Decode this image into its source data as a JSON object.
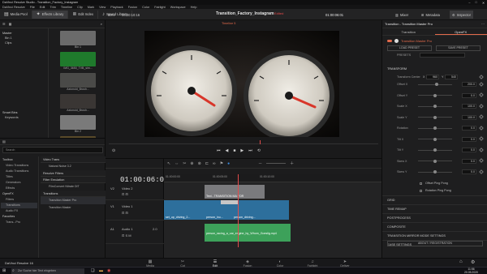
{
  "titlebar": {
    "title": "DaVinci Resolve Studio - Transition_Factory_Instagram",
    "controls": [
      "–",
      "□",
      "✕"
    ]
  },
  "menu": [
    "DaVinci Resolve",
    "File",
    "Edit",
    "Trim",
    "Timeline",
    "Clip",
    "Mark",
    "View",
    "Playback",
    "Fusion",
    "Color",
    "Fairlight",
    "Workspace",
    "Help"
  ],
  "toolbar": {
    "media_pool": "Media Pool",
    "effects_library": "Effects Library",
    "edit_index": "Edit Index",
    "sound_library": "Sound Library",
    "project": "Transition_Factory_Instagram",
    "edited": "Edited",
    "timecode": "01:00:06:01",
    "zoom": "80%",
    "zoom_tc": "00:00:10:16",
    "mixer": "Mixer",
    "metadata": "Metadata",
    "inspector": "Inspector"
  },
  "mediapool": {
    "bins": [
      "Master",
      "Bin 1",
      "Clips"
    ],
    "smart_bins": "Smart Bins",
    "keywords": "Keywords",
    "clips": [
      {
        "name": "Bin 1",
        "color": "#6b6b6b"
      },
      {
        "name": "IMG_3650_TVB_sim...",
        "color": "#1f7a2c"
      },
      {
        "name": "Axionoid_Brush...",
        "color": "#4a4a48"
      },
      {
        "name": "Axionoid_Brush...",
        "color": "#3a3634"
      },
      {
        "name": "Bin 2",
        "color": "#7a7a7a"
      },
      {
        "name": "clip_05.mp4",
        "color": "#5a4a2a"
      },
      {
        "name": "clip_06.mp4",
        "color": "#c7b99a"
      }
    ]
  },
  "effects": {
    "search_placeholder": "Search",
    "tree": [
      {
        "label": "Toolbox",
        "h": true
      },
      {
        "label": "Video Transitions",
        "h": false,
        "sel": false
      },
      {
        "label": "Audio Transitions",
        "h": false,
        "sel": false
      },
      {
        "label": "Titles",
        "h": false,
        "sel": false
      },
      {
        "label": "Generators",
        "h": false,
        "sel": false
      },
      {
        "label": "Effects",
        "h": false,
        "sel": false
      },
      {
        "label": "OpenFX",
        "h": true
      },
      {
        "label": "Filters",
        "h": false,
        "sel": false
      },
      {
        "label": "Transitions",
        "h": false,
        "sel": true
      },
      {
        "label": "Audio FX",
        "h": false,
        "sel": false
      },
      {
        "label": "Favorites",
        "h": true
      },
      {
        "label": "Trans...Pro",
        "h": false,
        "sel": false
      }
    ],
    "sections": [
      {
        "title": "Resolve Filters",
        "items": []
      },
      {
        "title": "Filter Emulation",
        "items": [
          {
            "label": "FilmConvert Nitrate DIT",
            "sel": false
          }
        ]
      },
      {
        "title": "Transitions",
        "items": [
          {
            "label": "Transition Master Pro",
            "sel": true
          },
          {
            "label": "Transition Master",
            "sel": false
          }
        ]
      }
    ],
    "video_label": "Video Trans",
    "fx_item1": "Natural Noise 3.2"
  },
  "viewer": {
    "timeline_name": "Timeline 5",
    "timecode": "01:00:06:01",
    "zoom": "Fit"
  },
  "timeline": {
    "tc": "01:00:06:01",
    "ruler": [
      "01:00:00:00",
      "01:00:05:00",
      "01:00:10:00"
    ],
    "tracks": [
      {
        "id": "V2",
        "name": "Video 2"
      },
      {
        "id": "V1",
        "name": "Video 1"
      },
      {
        "id": "A1",
        "name": "Audio 1",
        "level": "2.0"
      }
    ],
    "clips": {
      "title": "Text - TRANSITION MA FOR",
      "v1a": "set_up_driving_2...",
      "v1b": "person_inu...",
      "v1c": "person_driving...",
      "audio": "person_racing_a_car_engine_by_Whom_Goeslig.mp4"
    }
  },
  "inspector": {
    "title": "Transition - Transition Master Pro",
    "tabs": [
      "Transition",
      "OpenFX"
    ],
    "plugin": "Transition Master Pro",
    "load_preset": "LOAD PRESET",
    "save_preset": "SAVE PRESET",
    "presets_label": "PRESETS",
    "transform": "TRANSFORM",
    "transform_center_label": "Transform Center",
    "center_x_label": "X",
    "center_x": "960",
    "center_y_label": "Y",
    "center_y": "540",
    "params": [
      {
        "label": "Offset X",
        "value": "200.0",
        "knob": 0.55
      },
      {
        "label": "Offset Y",
        "value": "0.0",
        "knob": 0.5
      },
      {
        "label": "Scale X",
        "value": "100.0",
        "knob": 0.5
      },
      {
        "label": "Scale Y",
        "value": "100.0",
        "knob": 0.5
      },
      {
        "label": "Rotation",
        "value": "0.0",
        "knob": 0.5
      },
      {
        "label": "Tilt X",
        "value": "0.0",
        "knob": 0.5
      },
      {
        "label": "Tilt Y",
        "value": "0.0",
        "knob": 0.5
      },
      {
        "label": "Skew X",
        "value": "0.0",
        "knob": 0.5
      },
      {
        "label": "Skew Y",
        "value": "0.0",
        "knob": 0.5
      }
    ],
    "offset_ping_pong": "Offset Ping Pong",
    "rotation_ping_pong": "Rotation Ping Pong",
    "sections": [
      "GRID",
      "TIME REMAP",
      "POSTPROCESS",
      "COMPOSITE",
      "TRANSITION MIRROR MODE SETTINGS",
      "EASE SETTINGS"
    ],
    "about": "ABOUT / REGISTRATION"
  },
  "pages": [
    {
      "label": "Media",
      "icon": "▦",
      "active": false
    },
    {
      "label": "Cut",
      "icon": "✂",
      "active": false
    },
    {
      "label": "Edit",
      "icon": "☰",
      "active": true
    },
    {
      "label": "Fusion",
      "icon": "◈",
      "active": false
    },
    {
      "label": "Color",
      "icon": "◐",
      "active": false
    },
    {
      "label": "Fairlight",
      "icon": "♫",
      "active": false
    },
    {
      "label": "Deliver",
      "icon": "➤",
      "active": false
    }
  ],
  "app_name": "DaVinci Resolve 16",
  "taskbar": {
    "search": "Zur Suche hier Text eingeben",
    "time": "11:56",
    "date": "20.05.2020"
  },
  "colors": {
    "accent": "#e26a4b",
    "timeline_clip": "#2d6f9c",
    "audio_clip": "#3da15a",
    "playhead": "#e24b4b"
  }
}
